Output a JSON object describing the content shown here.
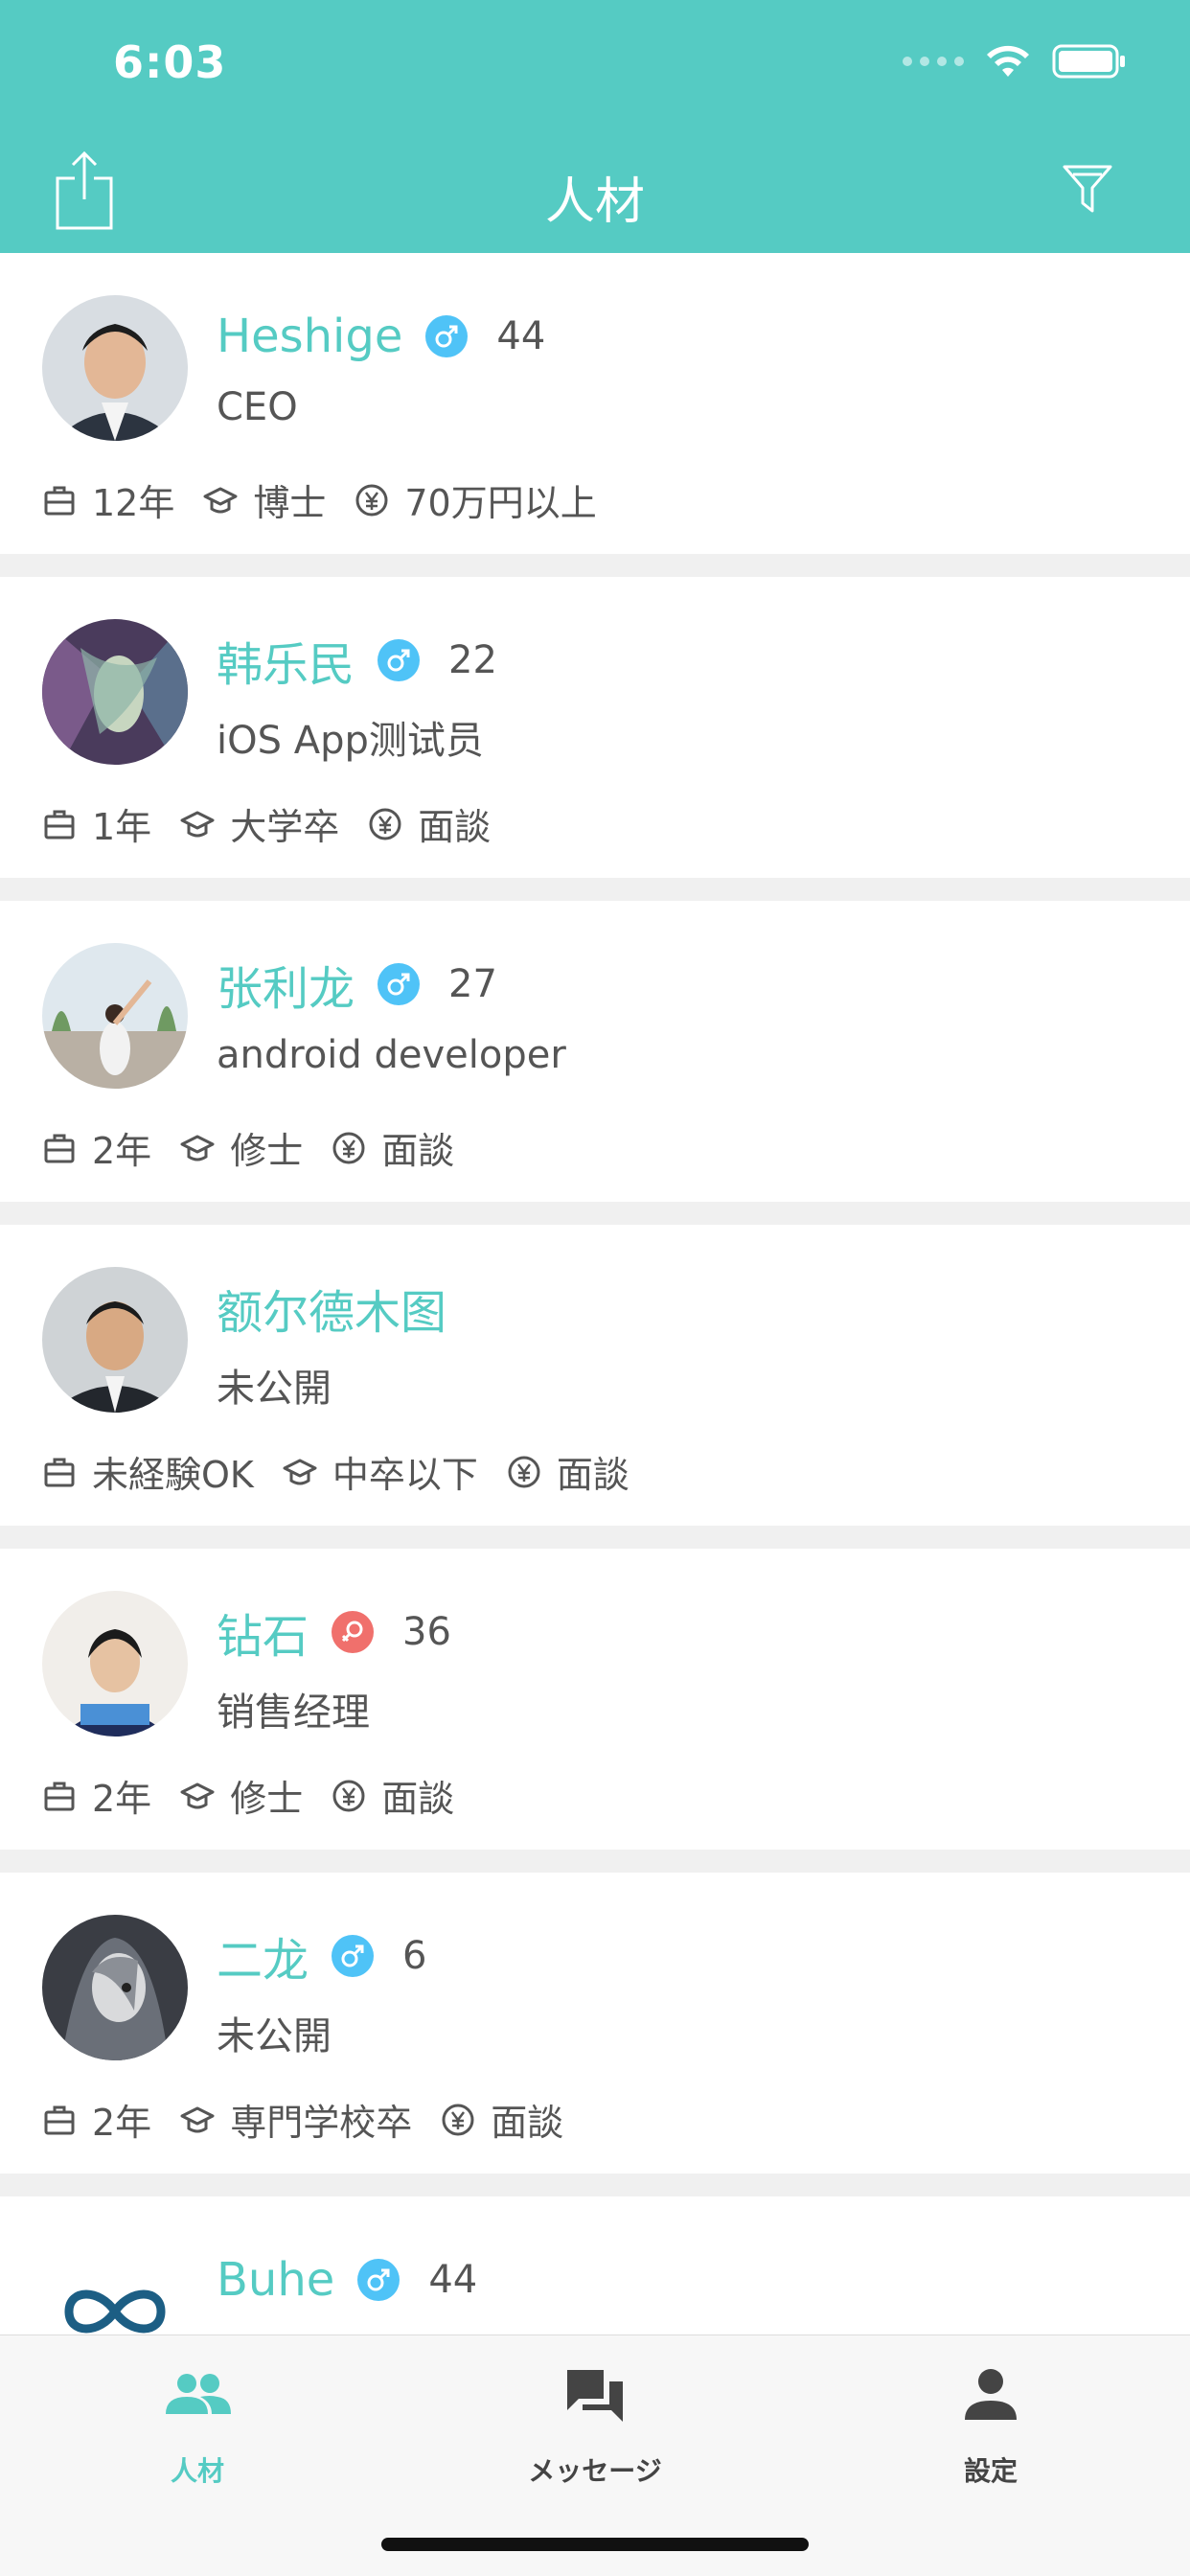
{
  "status_bar": {
    "time": "6:03"
  },
  "nav": {
    "title": "人材"
  },
  "colors": {
    "accent": "#55cbc3",
    "male": "#4fc3f7",
    "female": "#f0706c"
  },
  "candidates": [
    {
      "name": "Heshige",
      "gender": "male",
      "age": "44",
      "title": "CEO",
      "experience": "12年",
      "education": "博士",
      "salary": "70万円以上"
    },
    {
      "name": "韩乐民",
      "gender": "male",
      "age": "22",
      "title": "iOS App测试员",
      "experience": "1年",
      "education": "大学卒",
      "salary": "面談"
    },
    {
      "name": "张利龙",
      "gender": "male",
      "age": "27",
      "title": "android developer",
      "experience": "2年",
      "education": "修士",
      "salary": "面談"
    },
    {
      "name": "额尔德木图",
      "gender": "",
      "age": "",
      "title": "未公開",
      "experience": "未経験OK",
      "education": "中卒以下",
      "salary": "面談"
    },
    {
      "name": "钻石",
      "gender": "female",
      "age": "36",
      "title": "销售经理",
      "experience": "2年",
      "education": "修士",
      "salary": "面談"
    },
    {
      "name": "二龙",
      "gender": "male",
      "age": "6",
      "title": "未公開",
      "experience": "2年",
      "education": "専門学校卒",
      "salary": "面談"
    },
    {
      "name": "Buhe",
      "gender": "male",
      "age": "44"
    }
  ],
  "tabs": [
    {
      "label": "人材",
      "icon": "people-icon",
      "active": true
    },
    {
      "label": "メッセージ",
      "icon": "chat-icon",
      "active": false
    },
    {
      "label": "設定",
      "icon": "person-icon",
      "active": false
    }
  ]
}
